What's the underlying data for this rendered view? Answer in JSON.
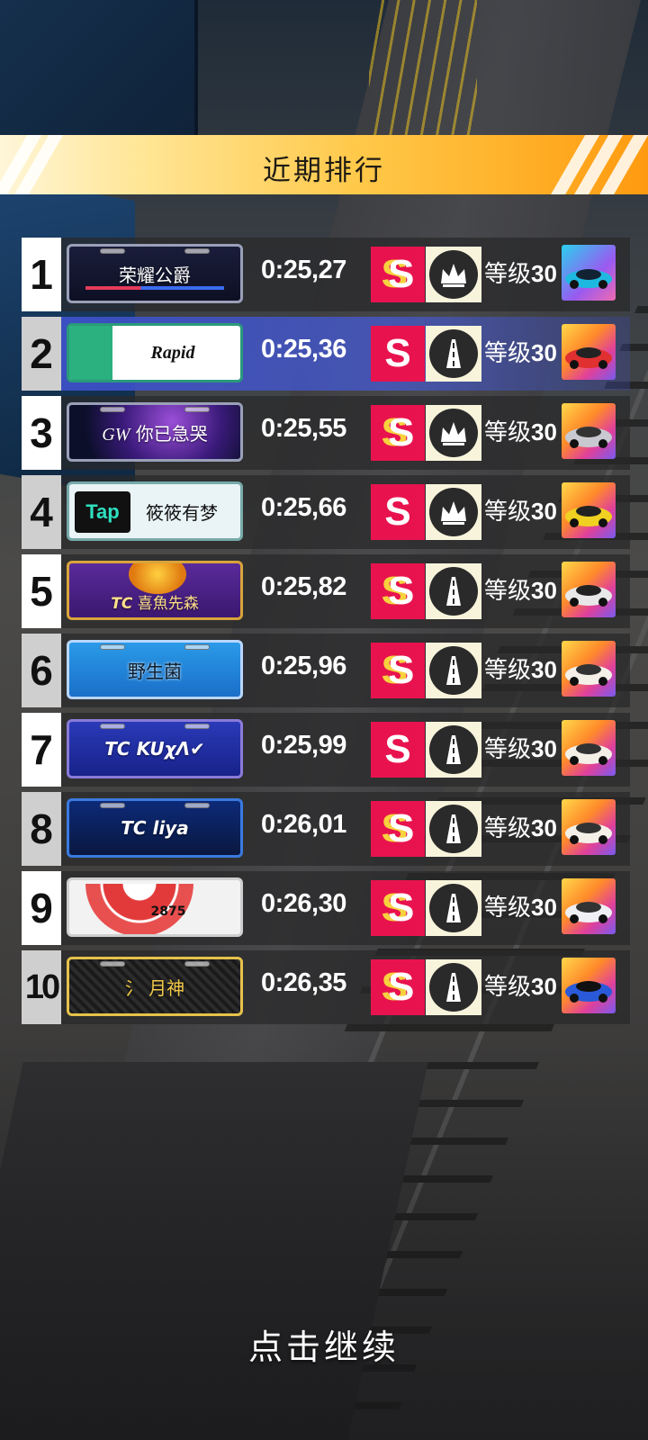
{
  "header": {
    "title": "近期排行"
  },
  "footer": {
    "continue_label": "点击继续"
  },
  "colors": {
    "banner_start": "#fff6d9",
    "banner_end": "#ff9a10",
    "grade_bg": "#e8134e",
    "highlight_row": "#3c50c8"
  },
  "leaderboard": [
    {
      "rank": "1",
      "plate": "荣耀公爵",
      "time": "0:25,27",
      "grade": "SS",
      "badge_icon": "crown-icon",
      "level_label": "等级",
      "level_value": "30",
      "car_color": "#2ad0f0"
    },
    {
      "rank": "2",
      "plate": "Rapid",
      "time": "0:25,36",
      "grade": "S",
      "badge_icon": "road-icon",
      "level_label": "等级",
      "level_value": "30",
      "car_color": "#e03030",
      "highlighted": true
    },
    {
      "rank": "3",
      "plate": "你已急哭",
      "time": "0:25,55",
      "grade": "SS",
      "badge_icon": "crown-icon",
      "level_label": "等级",
      "level_value": "30",
      "car_color": "#c8c8d0"
    },
    {
      "rank": "4",
      "plate": "筱筱有梦",
      "time": "0:25,66",
      "grade": "S",
      "badge_icon": "crown-icon",
      "level_label": "等级",
      "level_value": "30",
      "car_color": "#f0d020"
    },
    {
      "rank": "5",
      "plate": "喜魚先森",
      "time": "0:25,82",
      "grade": "SS",
      "badge_icon": "road-icon",
      "level_label": "等级",
      "level_value": "30",
      "car_color": "#e8e8e8"
    },
    {
      "rank": "6",
      "plate": "野生菌",
      "time": "0:25,96",
      "grade": "SS",
      "badge_icon": "road-icon",
      "level_label": "等级",
      "level_value": "30",
      "car_color": "#f4f0e8"
    },
    {
      "rank": "7",
      "plate": "KUχΛ✔",
      "time": "0:25,99",
      "grade": "S",
      "badge_icon": "road-icon",
      "level_label": "等级",
      "level_value": "30",
      "car_color": "#f4f0e8"
    },
    {
      "rank": "8",
      "plate": "liya",
      "time": "0:26,01",
      "grade": "SS",
      "badge_icon": "road-icon",
      "level_label": "等级",
      "level_value": "30",
      "car_color": "#f4f0e8"
    },
    {
      "rank": "9",
      "plate": "2875",
      "time": "0:26,30",
      "grade": "SS",
      "badge_icon": "road-icon",
      "level_label": "等级",
      "level_value": "30",
      "car_color": "#f0f0f4"
    },
    {
      "rank": "10",
      "plate": "月神",
      "time": "0:26,35",
      "grade": "SS",
      "badge_icon": "road-icon",
      "level_label": "等级",
      "level_value": "30",
      "car_color": "#2a5ad8"
    }
  ],
  "plate_prefixes": {
    "row3": "GW",
    "row5": "TC",
    "row7": "TC",
    "row8": "TC",
    "row10": "氵"
  },
  "plate_logos": {
    "row4": "Tap"
  }
}
